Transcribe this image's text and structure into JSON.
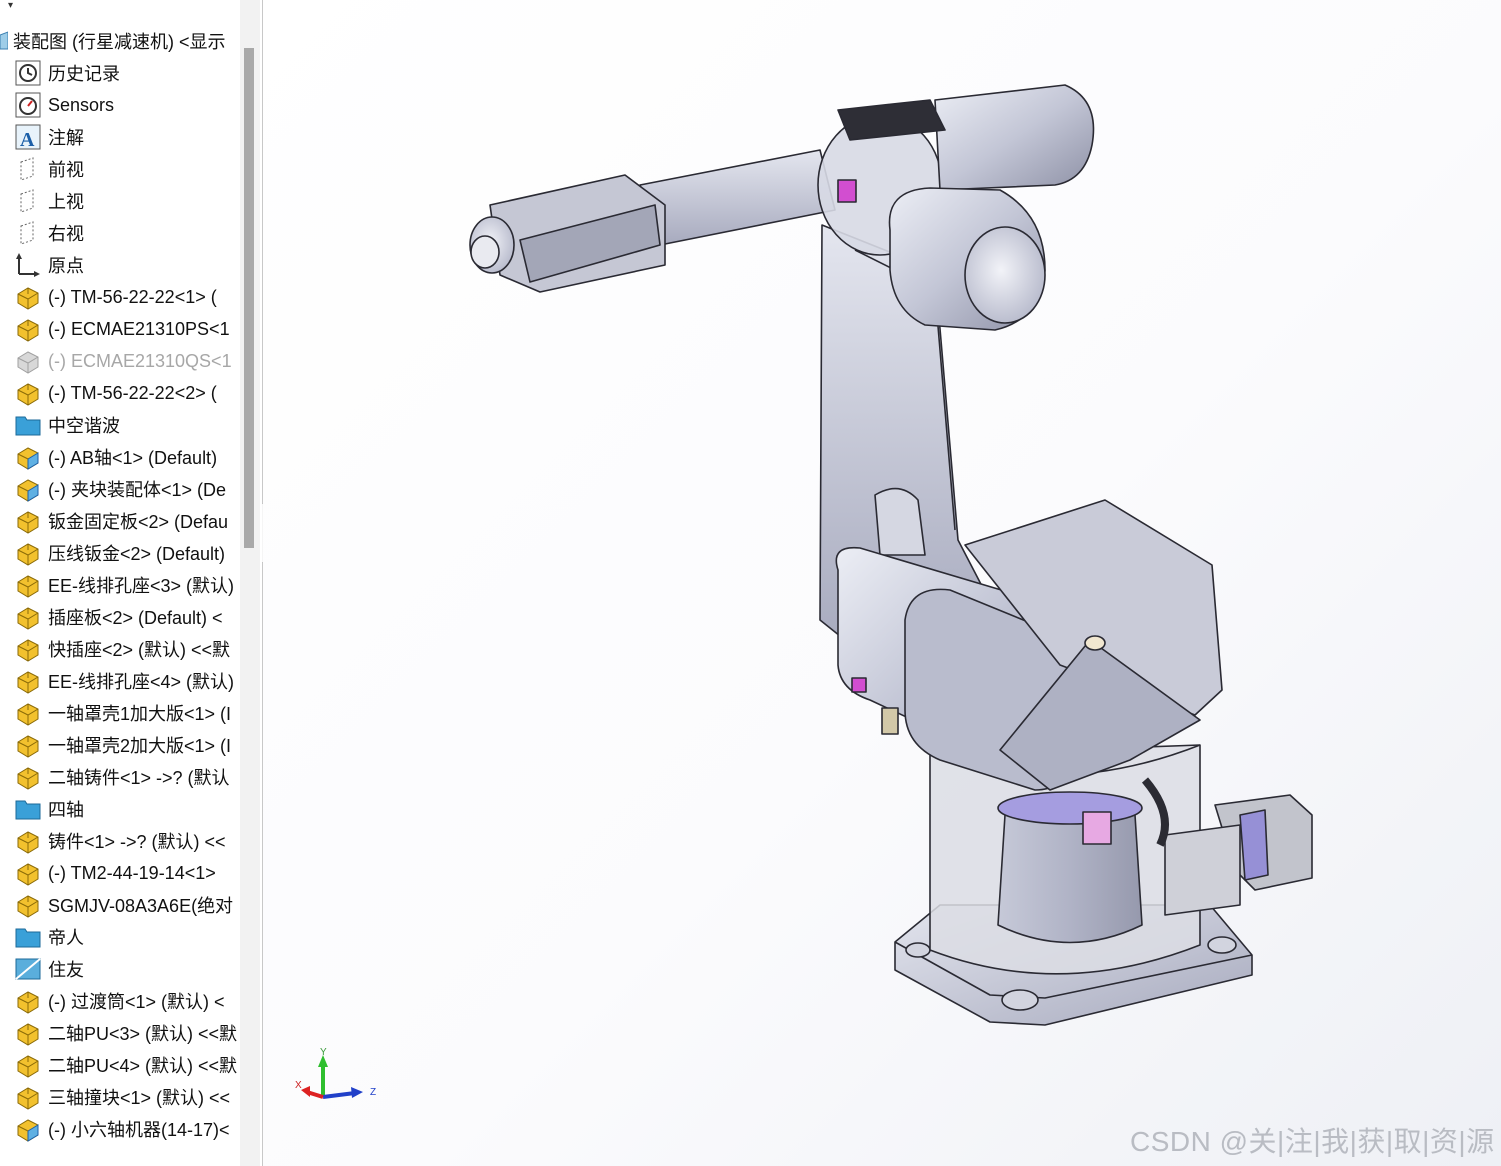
{
  "feature_tree": {
    "root_label": "装配图 (行星减速机) <显示",
    "items": [
      {
        "icon": "history-icon",
        "label": "历史记录"
      },
      {
        "icon": "sensors-icon",
        "label": "Sensors"
      },
      {
        "icon": "annotations-icon",
        "label": "注解"
      },
      {
        "icon": "plane-icon",
        "label": "前视"
      },
      {
        "icon": "plane-icon",
        "label": "上视"
      },
      {
        "icon": "plane-icon",
        "label": "右视"
      },
      {
        "icon": "origin-icon",
        "label": "原点"
      },
      {
        "icon": "part-icon",
        "label": "(-) TM-56-22-22<1> ("
      },
      {
        "icon": "part-icon",
        "label": "(-) ECMAE21310PS<1"
      },
      {
        "icon": "part-suppressed-icon",
        "label": "(-) ECMAE21310QS<1",
        "suppressed": true
      },
      {
        "icon": "part-icon",
        "label": "(-) TM-56-22-22<2> ("
      },
      {
        "icon": "folder-icon",
        "label": "中空谐波"
      },
      {
        "icon": "assembly-icon",
        "label": "(-) AB轴<1> (Default)"
      },
      {
        "icon": "assembly-icon",
        "label": "(-) 夹块装配体<1> (De"
      },
      {
        "icon": "part-icon",
        "label": "钣金固定板<2> (Defau"
      },
      {
        "icon": "part-icon",
        "label": "压线钣金<2> (Default)"
      },
      {
        "icon": "part-icon",
        "label": "EE-线排孔座<3> (默认)"
      },
      {
        "icon": "part-icon",
        "label": "插座板<2> (Default) <"
      },
      {
        "icon": "part-icon",
        "label": "快插座<2> (默认) <<默"
      },
      {
        "icon": "part-icon",
        "label": "EE-线排孔座<4> (默认)"
      },
      {
        "icon": "part-icon",
        "label": "一轴罩壳1加大版<1> (I"
      },
      {
        "icon": "part-icon",
        "label": "一轴罩壳2加大版<1> (I"
      },
      {
        "icon": "part-icon",
        "label": "二轴铸件<1> ->? (默认"
      },
      {
        "icon": "folder-icon",
        "label": "四轴"
      },
      {
        "icon": "part-icon",
        "label": "铸件<1> ->? (默认) <<"
      },
      {
        "icon": "part-icon",
        "label": "(-) TM2-44-19-14<1>"
      },
      {
        "icon": "part-icon",
        "label": "SGMJV-08A3A6E(绝对"
      },
      {
        "icon": "folder-icon",
        "label": "帝人"
      },
      {
        "icon": "folder-open-icon",
        "label": "住友"
      },
      {
        "icon": "part-icon",
        "label": "(-) 过渡筒<1> (默认) <"
      },
      {
        "icon": "part-icon",
        "label": "二轴PU<3> (默认) <<默"
      },
      {
        "icon": "part-icon",
        "label": "二轴PU<4> (默认) <<默"
      },
      {
        "icon": "part-icon",
        "label": "三轴撞块<1> (默认) <<"
      },
      {
        "icon": "assembly-icon",
        "label": "(-) 小六轴机器(14-17)<"
      }
    ]
  },
  "viewport": {
    "triad": {
      "x_label": "X",
      "y_label": "Y",
      "z_label": "Z"
    },
    "watermark": "CSDN @关|注|我|获|取|资|源"
  },
  "colors": {
    "part_yellow": "#f2c12e",
    "folder_blue": "#3aa0d8",
    "metal_light": "#d9dbe6",
    "metal_mid": "#b3b6c9",
    "metal_dark": "#8b8ea3",
    "edge": "#2a2a33",
    "accent_pink": "#d74fd3",
    "accent_lavender": "#a39be0"
  }
}
